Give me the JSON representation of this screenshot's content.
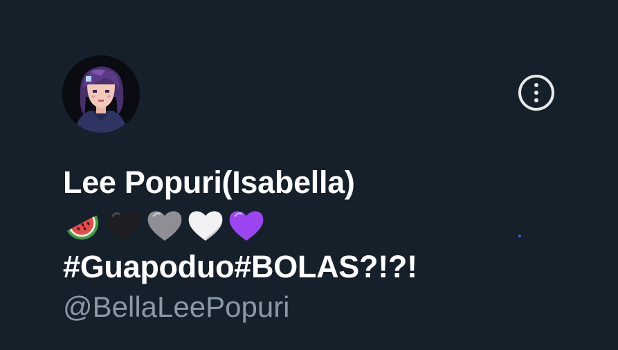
{
  "profile": {
    "display_name": "Lee Popuri(Isabella)",
    "name_emojis": [
      "watermelon-emoji",
      "black-heart-emoji",
      "grey-heart-emoji",
      "white-heart-emoji",
      "purple-heart-emoji"
    ],
    "hashtags": "#Guapoduo#BOLAS?!?!",
    "handle": "@BellaLeePopuri"
  },
  "header": {
    "more_icon": "more-vertical-icon"
  },
  "colors": {
    "background": "#16202b",
    "primary_text": "#ffffff",
    "secondary_text": "#8b98a5"
  }
}
